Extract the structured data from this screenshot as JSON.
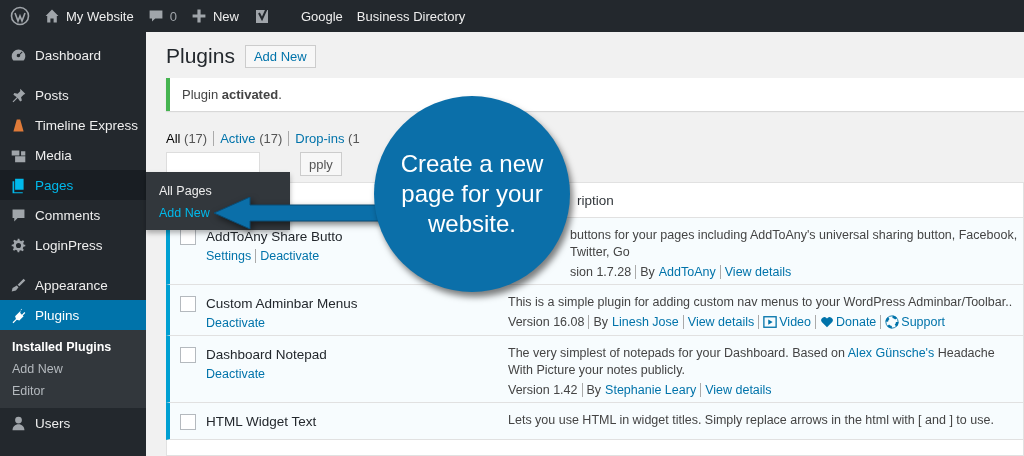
{
  "admin_bar": {
    "items": [
      {
        "kind": "logo"
      },
      {
        "kind": "home",
        "label": "My Website"
      },
      {
        "kind": "comments",
        "label": "0"
      },
      {
        "kind": "new",
        "label": "New"
      },
      {
        "kind": "yoast"
      },
      {
        "kind": "text",
        "label": "Google"
      },
      {
        "kind": "text",
        "label": "Business Directory"
      }
    ]
  },
  "sidebar": {
    "items": [
      {
        "kind": "gauge",
        "label": "Dashboard",
        "selected": false,
        "hovered": false,
        "separator_before": false
      },
      {
        "kind": "pin",
        "label": "Posts",
        "selected": false,
        "hovered": false,
        "separator_before": true
      },
      {
        "kind": "cone",
        "label": "Timeline Express",
        "selected": false,
        "hovered": false,
        "separator_before": false
      },
      {
        "kind": "media",
        "label": "Media",
        "selected": false,
        "hovered": false,
        "separator_before": false
      },
      {
        "kind": "pages",
        "label": "Pages",
        "selected": false,
        "hovered": true,
        "separator_before": false
      },
      {
        "kind": "comment",
        "label": "Comments",
        "selected": false,
        "hovered": false,
        "separator_before": false
      },
      {
        "kind": "gear",
        "label": "LoginPress",
        "selected": false,
        "hovered": false,
        "separator_before": false
      },
      {
        "kind": "brush",
        "label": "Appearance",
        "selected": false,
        "hovered": false,
        "separator_before": true
      },
      {
        "kind": "plug",
        "label": "Plugins",
        "selected": true,
        "hovered": false,
        "separator_before": false,
        "children": [
          {
            "label": "Installed Plugins",
            "selected": true
          },
          {
            "label": "Add New",
            "selected": false
          },
          {
            "label": "Editor",
            "selected": false
          }
        ]
      },
      {
        "kind": "user",
        "label": "Users",
        "selected": false,
        "hovered": false,
        "separator_before": false
      }
    ]
  },
  "flyout": {
    "items": [
      {
        "label": "All Pages",
        "highlighted": false
      },
      {
        "label": "Add New",
        "highlighted": true
      }
    ]
  },
  "page": {
    "title": "Plugins",
    "add_new": "Add New",
    "notice": "Plugin **activated**.",
    "filters": [
      {
        "label": "All",
        "count": "(17)",
        "selected": true
      },
      {
        "label": "Active",
        "count": "(17)",
        "selected": false
      },
      {
        "label": "Drop-ins",
        "count": "(1",
        "selected": false
      }
    ],
    "apply_button": "pply"
  },
  "table": {
    "description_header": "ription",
    "rows": [
      {
        "name": "AddToAny Share Butto",
        "active": true,
        "checked": false,
        "actions": [
          "Settings",
          "Deactivate"
        ],
        "description": [
          {
            "kind": "text",
            "label": "buttons for your pages including AddToAny's universal sharing button, Facebook, Twitter, Go"
          }
        ],
        "meta": [
          {
            "kind": "text",
            "label": "sion 1.7.28"
          },
          {
            "kind": "text",
            "label": "By"
          },
          {
            "kind": "link",
            "label": "AddToAny",
            "sep": false
          },
          {
            "kind": "link",
            "label": "View details"
          }
        ]
      },
      {
        "name": "Custom Adminbar Menus",
        "active": true,
        "checked": false,
        "actions": [
          "Deactivate"
        ],
        "description": [
          {
            "kind": "text",
            "label": "This is a simple plugin for adding custom nav menus to your WordPress Adminbar/Toolbar.."
          }
        ],
        "meta": [
          {
            "kind": "text",
            "label": "Version 16.08"
          },
          {
            "kind": "text",
            "label": "By"
          },
          {
            "kind": "link",
            "label": "Linesh Jose",
            "sep": false
          },
          {
            "kind": "link",
            "label": "View details"
          },
          {
            "kind": "video",
            "label": "Video"
          },
          {
            "kind": "donate",
            "label": "Donate"
          },
          {
            "kind": "support",
            "label": "Support"
          }
        ]
      },
      {
        "name": "Dashboard Notepad",
        "active": true,
        "checked": false,
        "actions": [
          "Deactivate"
        ],
        "description": [
          {
            "kind": "text",
            "label": "The very simplest of notepads for your Dashboard. Based on"
          },
          {
            "kind": "link",
            "label": "Alex Günsche's"
          },
          {
            "kind": "text",
            "label": "Headache With Picture your notes publicly."
          }
        ],
        "meta": [
          {
            "kind": "text",
            "label": "Version 1.42"
          },
          {
            "kind": "text",
            "label": "By"
          },
          {
            "kind": "link",
            "label": "Stephanie Leary",
            "sep": false
          },
          {
            "kind": "link",
            "label": "View details"
          }
        ]
      },
      {
        "name": "HTML Widget Text",
        "active": true,
        "checked": false,
        "actions": [],
        "description": [
          {
            "kind": "text",
            "label": "Lets you use HTML in widget titles. Simply replace arrows in the html with [ and ] to use."
          }
        ],
        "meta": []
      }
    ]
  },
  "callout": {
    "text": "Create a new page for your website."
  }
}
